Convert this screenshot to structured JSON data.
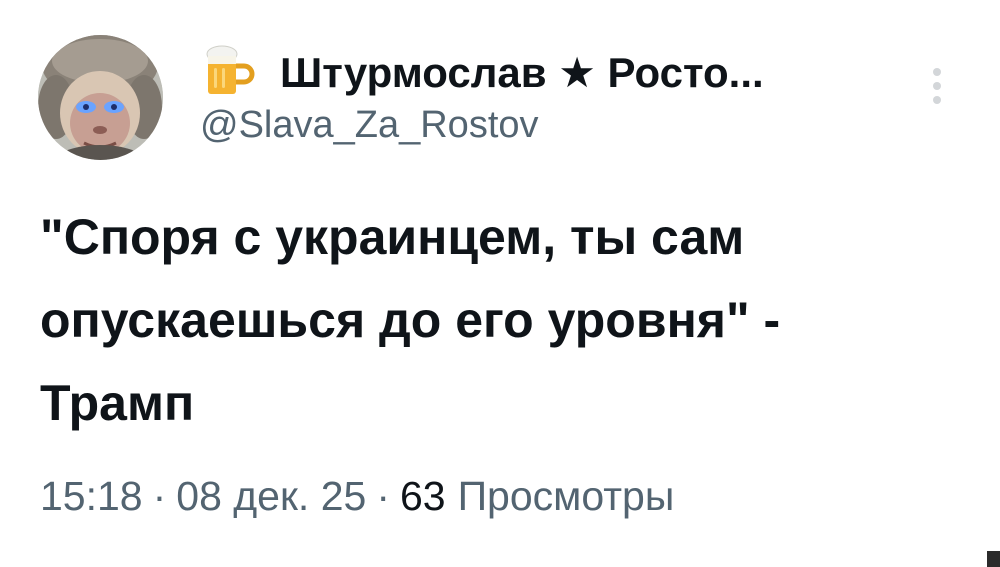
{
  "author": {
    "display_name": "Штурмослав ★ Росто...",
    "handle": "@Slava_Za_Rostov",
    "badge_icon": "beer-mug-icon",
    "avatar": "monkey-in-fur-hat-avatar"
  },
  "menu": {
    "icon": "vertical-dots-icon"
  },
  "tweet": {
    "text": "\"Споря с украинцем, ты сам\nопускаешься до его уровня\" -\nТрамп"
  },
  "meta": {
    "time": "15:18",
    "separator": "·",
    "date": "08 дек. 25",
    "views_count": "63",
    "views_label": "Просмотры"
  },
  "colors": {
    "text_primary": "#0f1419",
    "text_secondary": "#536471",
    "background": "#ffffff"
  }
}
